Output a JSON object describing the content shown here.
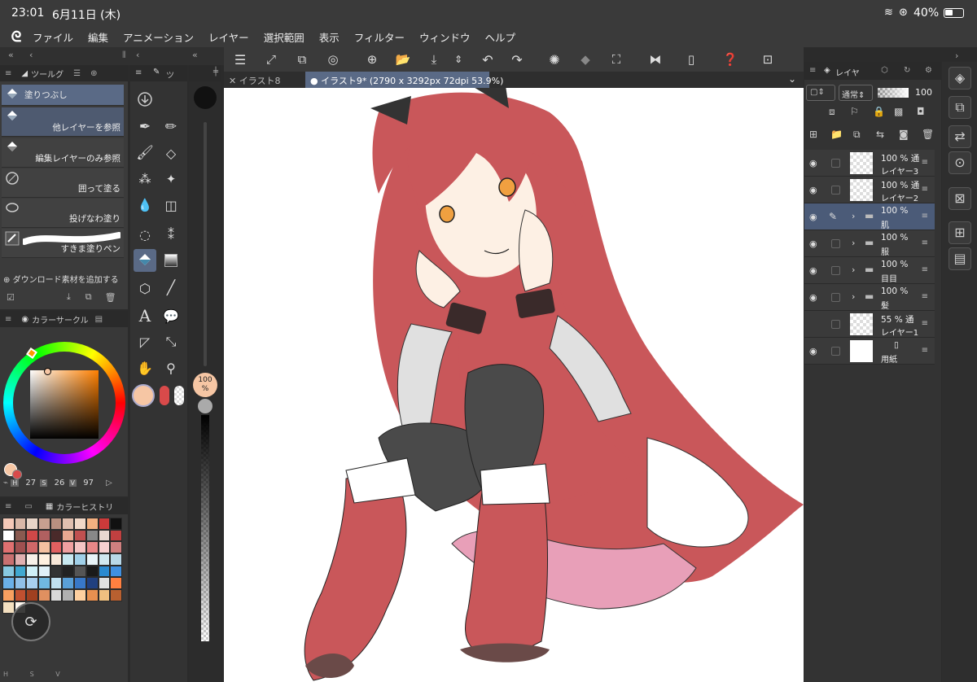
{
  "status": {
    "time": "23:01",
    "date": "6月11日 (木)",
    "battery": "40%"
  },
  "menu": {
    "items": [
      "ファイル",
      "編集",
      "アニメーション",
      "レイヤー",
      "選択範囲",
      "表示",
      "フィルター",
      "ウィンドウ",
      "ヘルプ"
    ]
  },
  "subtool": {
    "tab_label": "ツールグ",
    "tab2_label": "ツ",
    "items": [
      {
        "label": "塗りつぶし"
      },
      {
        "label": "他レイヤーを参照"
      },
      {
        "label": "編集レイヤーのみ参照"
      },
      {
        "label": "囲って塗る"
      },
      {
        "label": "投げなわ塗り"
      },
      {
        "label": "すきま塗りペン"
      }
    ],
    "add_material": "ダウンロード素材を追加する"
  },
  "color": {
    "tab_label": "カラーサークル",
    "h": "27",
    "s": "26",
    "v": "97",
    "h_label": "H",
    "s_label": "S",
    "v_label": "V",
    "main_color": "#f6c6a4",
    "sub_color": "#d94a4a"
  },
  "history": {
    "tab_label": "カラーヒストリ",
    "colors": [
      "#f4c9b8",
      "#d9b8a8",
      "#e8d5c8",
      "#c8a090",
      "#b89080",
      "#e0c0b0",
      "#f0d8c8",
      "#f4b080",
      "#cc3a3a",
      "#111111",
      "#ffffff",
      "#8a5a50",
      "#d04848",
      "#b06060",
      "#4a2a2a",
      "#e8a890",
      "#c05050",
      "#888888",
      "#e8d8d0",
      "#c04040",
      "#e07070",
      "#a05050",
      "#d06868",
      "#f4c0a0",
      "#e06060",
      "#f0a0a0",
      "#f4c4c4",
      "#e88888",
      "#f8d0d0",
      "#d08080",
      "#c87070",
      "#e0b0b0",
      "#f8f0e8",
      "#fff0e0",
      "#f8e8d8",
      "#c8e8f0",
      "#a0d0e8",
      "#e8f4f8",
      "#d0e8f0",
      "#b8d8e8",
      "#88c8e0",
      "#40a8d0",
      "#d0f0f8",
      "#e0f0f8",
      "#333333",
      "#222222",
      "#555555",
      "#1a1a1a",
      "#2a8ad0",
      "#4090e0",
      "#6ab0e8",
      "#90c0e8",
      "#a8d0f0",
      "#70b8e0",
      "#c0e0f0",
      "#5aa0d8",
      "#3878c8",
      "#204080",
      "#e0e0e0",
      "#ff8040",
      "#f8a060",
      "#c05030",
      "#a04020",
      "#e09060",
      "#d8d8d8",
      "#b0b0b0",
      "#ffd0a0",
      "#e89050",
      "#f0c080",
      "#b86030",
      "#f4e0c0",
      "#fff8f0"
    ]
  },
  "brush": {
    "opacity": "100",
    "opacity_unit": "%"
  },
  "tabs": [
    {
      "label": "イラスト8"
    },
    {
      "label": "イラスト9* (2790 x 3292px 72dpi 53.9%)"
    }
  ],
  "layers": {
    "tab_label": "レイヤ",
    "blend_mode": "通常",
    "opacity": "100",
    "rows": [
      {
        "pct": "100 %",
        "mode": "通",
        "name": "レイヤー3",
        "type": "raster"
      },
      {
        "pct": "100 %",
        "mode": "通",
        "name": "レイヤー2",
        "type": "raster"
      },
      {
        "pct": "100 %",
        "mode": "",
        "name": "肌",
        "type": "folder"
      },
      {
        "pct": "100 %",
        "mode": "",
        "name": "服",
        "type": "folder"
      },
      {
        "pct": "100 %",
        "mode": "",
        "name": "目目",
        "type": "folder"
      },
      {
        "pct": "100 %",
        "mode": "",
        "name": "髪",
        "type": "folder"
      },
      {
        "pct": "55 %",
        "mode": "通",
        "name": "レイヤー1",
        "type": "raster"
      },
      {
        "pct": "",
        "mode": "",
        "name": "用紙",
        "type": "paper"
      }
    ]
  }
}
